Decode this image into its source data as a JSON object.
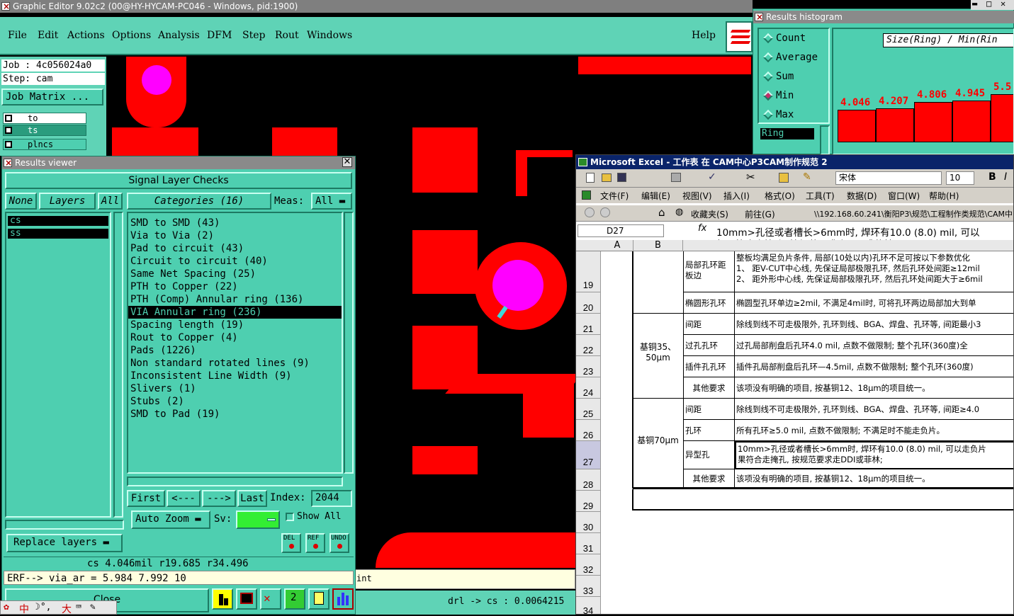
{
  "main_window": {
    "title": "Graphic Editor 9.02c2 (00@HY-HYCAM-PC046 - Windows, pid:1900)",
    "menu": [
      "File",
      "Edit",
      "Actions",
      "Options",
      "Analysis",
      "DFM",
      "Step",
      "Rout",
      "Windows"
    ],
    "help": "Help",
    "job_label": "Job : 4c056024a0",
    "step_label": "Step: cam",
    "job_matrix_button": "Job Matrix ...",
    "layers": [
      "to",
      "ts",
      "plncs"
    ]
  },
  "results_viewer": {
    "title": "Results viewer",
    "header": "Signal Layer Checks",
    "none_button": "None",
    "layers_button": "Layers",
    "all_button": "All",
    "layer_list": [
      "cs",
      "ss"
    ],
    "categories_button": "Categories (16)",
    "meas_label": "Meas:",
    "meas_value": "All",
    "categories": [
      "SMD to SMD (43)",
      "Via to Via (2)",
      "Pad to circuit (43)",
      "Circuit to circuit (40)",
      "Same Net Spacing (25)",
      "PTH to Copper (22)",
      "PTH (Comp) Annular ring (136)",
      "VIA Annular ring (236)",
      "Spacing length (19)",
      "Rout to Copper (4)",
      "Pads (1226)",
      "Non standard rotated lines (9)",
      "Inconsistent Line Width (9)",
      "Slivers (1)",
      "Stubs (2)",
      "SMD to Pad (19)"
    ],
    "selected_category_index": 7,
    "first_button": "First",
    "prev_button": "<---",
    "next_button": "--->",
    "last_button": "Last",
    "index_label": "Index:",
    "index_value": "2044",
    "auto_zoom_button": "Auto Zoom",
    "sv_label": "Sv:",
    "show_all_label": "Show All",
    "replace_layers_button": "Replace layers",
    "del_label": "DEL",
    "ref_label": "REF",
    "undo_label": "UNDO",
    "status_line": "cs 4.046mil  r19.685  r34.496",
    "erf_line": "ERF--> via_ar = 5.984 7.992 10",
    "close_button": "Close"
  },
  "bottom_status": {
    "int_text": "int",
    "drl_text": "drl -> cs : 0.0064215"
  },
  "histogram": {
    "title": "Results histogram",
    "options": [
      "Count",
      "Average",
      "Sum",
      "Min",
      "Max"
    ],
    "selected_option": "Min",
    "ring_field": "Ring",
    "chart_title": "Size(Ring) / Min(Rin",
    "bar_labels": [
      "4.046",
      "4.207",
      "4.806",
      "4.945",
      "5.5"
    ]
  },
  "chart_data": {
    "type": "bar",
    "title": "Size(Ring) / Min(Rin",
    "values": [
      4.046,
      4.207,
      4.806,
      4.945,
      5.5
    ]
  },
  "excel": {
    "title": "Microsoft Excel - 工作表 在 CAM中心P3CAM制作规范 2",
    "font_name": "宋体",
    "font_size": "10",
    "menus": [
      "文件(F)",
      "编辑(E)",
      "视图(V)",
      "插入(I)",
      "格式(O)",
      "工具(T)",
      "数据(D)",
      "窗口(W)",
      "帮助(H)"
    ],
    "favorites": "收藏夹(S)",
    "goto": "前往(G)",
    "path": "\\\\192.168.60.241\\衡阳P3\\规范\\工程制作类规范\\CAM中",
    "name_box": "D27",
    "formula": "10mm>孔径或者槽长>6mm时, 焊环有10.0 (8.0) mil, 可以",
    "formula2": "如果符合走掩孔, 按规范要求走DDI或菲林;",
    "col_headers": [
      "A",
      "B"
    ],
    "row_numbers": [
      "19",
      "20",
      "21",
      "22",
      "23",
      "24",
      "25",
      "26",
      "27",
      "28",
      "29",
      "30",
      "31",
      "32",
      "33",
      "34"
    ],
    "group1": "基铜35、50μm",
    "group2": "基铜70μm",
    "rows": [
      {
        "c": "局部孔环距板边",
        "d": "整板均满足负片条件, 局部(10处以内)孔环不足可按以下参数优化",
        "d2": "1、 距V-CUT中心线, 先保证局部极限孔环, 然后孔环处间距≥12mil",
        "d3": "2、 距外形中心线, 先保证局部极限孔环, 然后孔环处间距大于≥6mil"
      },
      {
        "c": "椭圆形孔环",
        "d": "椭圆型孔环单边≥2mil, 不满足4mil时, 可将孔环两边局部加大到单"
      },
      {
        "c": "间距",
        "d": "除线到线不可走极限外, 孔环到线、BGA、焊盘、孔环等, 间距最小3"
      },
      {
        "c": "过孔孔环",
        "d": "过孔局部削盘后孔环4.0 mil, 点数不做限制; 整个孔环(360度)全"
      },
      {
        "c": "插件孔孔环",
        "d": "插件孔局部削盘后孔环—4.5mil, 点数不做限制; 整个孔环(360度)"
      },
      {
        "c": "其他要求",
        "d": "该项没有明确的项目, 按基铜12、18μm的项目统一。"
      },
      {
        "c": "间距",
        "d": "除线到线不可走极限外, 孔环到线、BGA、焊盘、孔环等, 间距≥4.0"
      },
      {
        "c": "孔环",
        "d": "所有孔环≥5.0 mil, 点数不做限制; 不满足时不能走负片。"
      },
      {
        "c": "异型孔",
        "d": "10mm>孔径或者槽长>6mm时, 焊环有10.0 (8.0) mil, 可以走负片",
        "d2": "果符合走掩孔, 按规范要求走DDI或菲林;"
      },
      {
        "c": "其他要求",
        "d": "该项没有明确的项目, 按基铜12、18μm的项目统一。"
      }
    ]
  },
  "taskbar": {
    "ime_text": "中",
    "ime_text2": "大"
  }
}
